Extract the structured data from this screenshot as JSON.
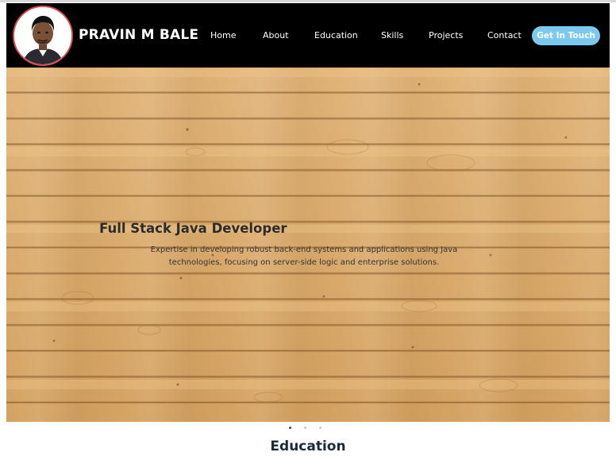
{
  "brand": {
    "name": "PRAVIN M BALE"
  },
  "nav": {
    "items": [
      {
        "label": "Home"
      },
      {
        "label": "About"
      },
      {
        "label": "Education"
      },
      {
        "label": "Skills"
      },
      {
        "label": "Projects"
      },
      {
        "label": "Contact"
      }
    ],
    "cta_label": "Get In Touch"
  },
  "hero": {
    "title": "Full Stack Java Developer",
    "description": "Expertise in developing robust back-end systems and applications using Java technologies, focusing on server-side logic and enterprise solutions.",
    "slides_count": 3,
    "active_slide": 1
  },
  "section": {
    "title": "Education"
  },
  "colors": {
    "navbar_bg": "#000000",
    "cta_bg": "#7cc9f0",
    "avatar_border": "#e0484d",
    "wood": "#d9a865",
    "heading": "#1b2a3a"
  }
}
